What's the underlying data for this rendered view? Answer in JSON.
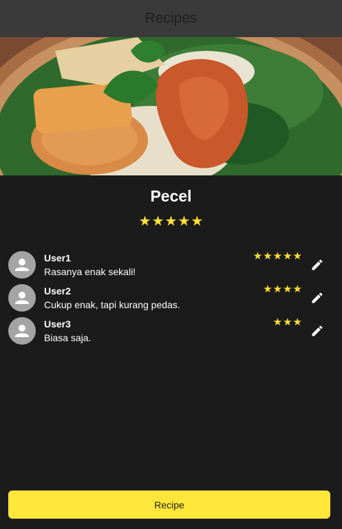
{
  "app_bar": {
    "title": "Recipes"
  },
  "recipe": {
    "name": "Pecel",
    "rating": 5,
    "image_icon": "food-photo"
  },
  "reviews": [
    {
      "user": "User1",
      "text": "Rasanya enak sekali!",
      "rating": 5
    },
    {
      "user": "User2",
      "text": "Cukup enak, tapi kurang pedas.",
      "rating": 4
    },
    {
      "user": "User3",
      "text": "Biasa saja.",
      "rating": 3
    }
  ],
  "actions": {
    "recipe_label": "Recipe"
  },
  "colors": {
    "background": "#1c1b1b",
    "app_bar": "#3b3a3a",
    "accent_yellow": "#ffe63b",
    "star": "#ffe13b",
    "avatar": "#a4a4a4"
  },
  "icons": {
    "avatar": "person-icon",
    "edit": "pencil-icon",
    "star": "star-icon"
  }
}
